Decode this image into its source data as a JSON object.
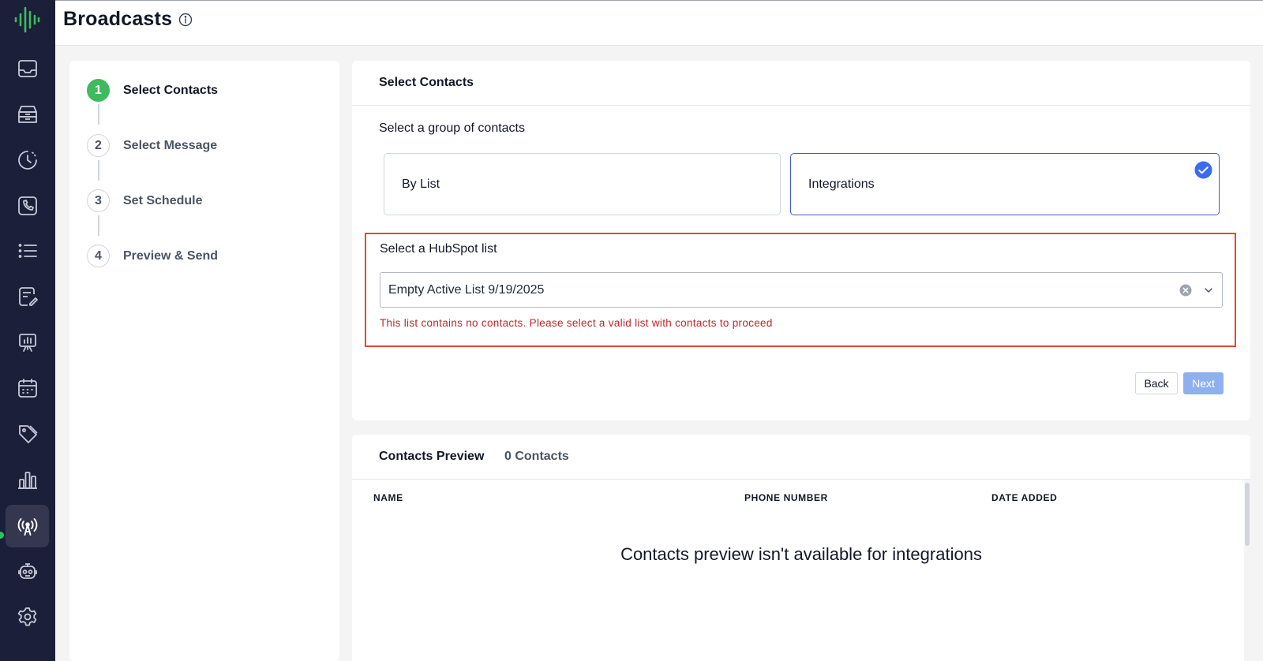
{
  "header": {
    "title": "Broadcasts"
  },
  "sidebar": {
    "items": [
      {
        "icon": "inbox-icon"
      },
      {
        "icon": "archive-icon"
      },
      {
        "icon": "history-icon"
      },
      {
        "icon": "phone-icon"
      },
      {
        "icon": "list-icon"
      },
      {
        "icon": "templates-icon"
      },
      {
        "icon": "presentation-icon"
      },
      {
        "icon": "calendar-icon"
      },
      {
        "icon": "tag-icon"
      },
      {
        "icon": "bar-chart-icon"
      },
      {
        "icon": "broadcast-icon",
        "active": true
      },
      {
        "icon": "bot-icon"
      },
      {
        "icon": "gear-icon"
      }
    ]
  },
  "steps": [
    {
      "number": "1",
      "label": "Select Contacts",
      "state": "current"
    },
    {
      "number": "2",
      "label": "Select Message",
      "state": "pending"
    },
    {
      "number": "3",
      "label": "Set Schedule",
      "state": "pending"
    },
    {
      "number": "4",
      "label": "Preview & Send",
      "state": "pending"
    }
  ],
  "select_contacts": {
    "title": "Select Contacts",
    "group_label": "Select a group of contacts",
    "options": [
      {
        "label": "By List",
        "selected": false
      },
      {
        "label": "Integrations",
        "selected": true
      }
    ],
    "hubspot": {
      "label": "Select a HubSpot list",
      "value": "Empty Active List 9/19/2025",
      "error": "This list contains no contacts. Please select a valid list with contacts to proceed"
    },
    "back_label": "Back",
    "next_label": "Next"
  },
  "preview": {
    "title": "Contacts Preview",
    "count": "0 Contacts",
    "columns": [
      "NAME",
      "PHONE NUMBER",
      "DATE ADDED"
    ],
    "empty_message": "Contacts preview isn't available for integrations"
  },
  "colors": {
    "sidebar_bg": "#1c1f3a",
    "step_done": "#3fba5c",
    "selected_border": "#3b5bdb",
    "check": "#3b6cf0",
    "highlight": "#e04b2b",
    "error": "#c0262d",
    "next_disabled": "#8fb0ee"
  }
}
